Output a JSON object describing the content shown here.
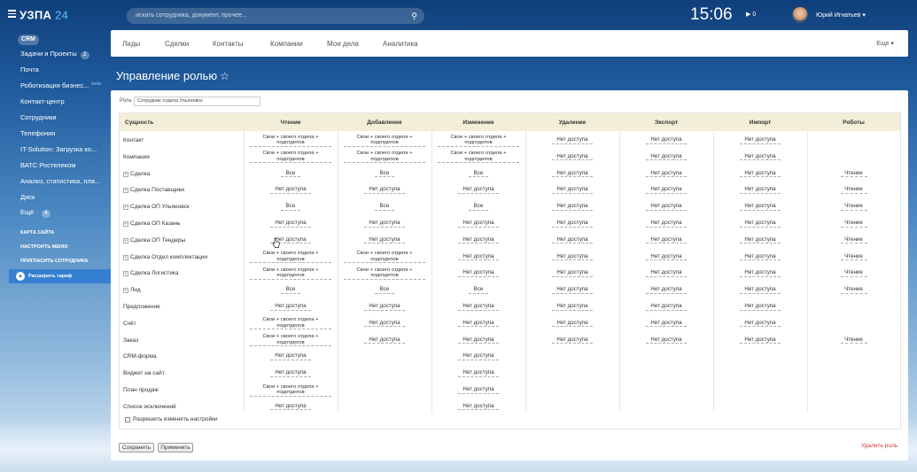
{
  "header": {
    "logo_text": "УЗПА",
    "logo_num": "24",
    "search_placeholder": "искать сотрудника, документ, прочее...",
    "clock": "15:06",
    "flag_count": "▶ 0",
    "user_name": "Юрий Игнатьев ▾"
  },
  "leftmenu": {
    "crm": "CRM",
    "items": [
      {
        "label": "Задачи и Проекты",
        "count": "2"
      },
      {
        "label": "Почта"
      },
      {
        "label": "Роботизация бизнес...",
        "beta": "beta"
      },
      {
        "label": "Контакт-центр"
      },
      {
        "label": "Сотрудники"
      },
      {
        "label": "Телефония"
      },
      {
        "label": "IT-Solution: Загрузка ко..."
      },
      {
        "label": "ВАТС Ростелеком"
      },
      {
        "label": "Анализ, статистика, пла..."
      },
      {
        "label": "Диск"
      },
      {
        "label": "Ещё ·",
        "count": "4"
      }
    ],
    "small_items": [
      "Карта сайта",
      "Настроить меню",
      "Пригласить сотрудника"
    ],
    "expand_label": "Расширить тариф"
  },
  "nav": {
    "items": [
      "Лиды",
      "Сделки",
      "Контакты",
      "Компании",
      "Мои дела",
      "Аналитика"
    ],
    "more": "Еще ▾"
  },
  "page": {
    "title": "Управление ролью",
    "star": "☆",
    "role_label": "Роль",
    "role_value": "Сотрудник отдела Ульяновск"
  },
  "table": {
    "columns": [
      "Сущность",
      "Чтение",
      "Добавление",
      "Изменение",
      "Удаление",
      "Экспорт",
      "Импорт",
      "Роботы"
    ],
    "rows": [
      {
        "name": "Контакт",
        "expand": false,
        "cells": [
          "Свои + своего отдела + подотделов",
          "Свои + своего отдела + подотделов",
          "Свои + своего отдела + подотделов",
          "Нет доступа",
          "Нет доступа",
          "Нет доступа",
          ""
        ]
      },
      {
        "name": "Компания",
        "expand": false,
        "cells": [
          "Свои + своего отдела + подотделов",
          "Свои + своего отдела + подотделов",
          "Свои + своего отдела + подотделов",
          "Нет доступа",
          "Нет доступа",
          "Нет доступа",
          ""
        ]
      },
      {
        "name": "Сделка",
        "expand": true,
        "cells": [
          "Все",
          "Все",
          "Все",
          "Нет доступа",
          "Нет доступа",
          "Нет доступа",
          "Чтение"
        ]
      },
      {
        "name": "Сделка Поставщики",
        "expand": true,
        "cells": [
          "Нет доступа",
          "Нет доступа",
          "Нет доступа",
          "Нет доступа",
          "Нет доступа",
          "Нет доступа",
          "Чтение"
        ]
      },
      {
        "name": "Сделка ОП Ульяновск",
        "expand": true,
        "cells": [
          "Все",
          "Все",
          "Все",
          "Нет доступа",
          "Нет доступа",
          "Нет доступа",
          "Чтение"
        ]
      },
      {
        "name": "Сделка ОП Казань",
        "expand": true,
        "cells": [
          "Нет доступа",
          "Нет доступа",
          "Нет доступа",
          "Нет доступа",
          "Нет доступа",
          "Нет доступа",
          "Чтение"
        ]
      },
      {
        "name": "Сделка ОП Тендеры",
        "expand": true,
        "cells": [
          "Нет доступа",
          "Нет доступа",
          "Нет доступа",
          "Нет доступа",
          "Нет доступа",
          "Нет доступа",
          "Чтение"
        ]
      },
      {
        "name": "Сделка Отдел комплектации",
        "expand": true,
        "cells": [
          "Свои + своего отдела + подотделов",
          "Свои + своего отдела + подотделов",
          "Нет доступа",
          "Нет доступа",
          "Нет доступа",
          "Нет доступа",
          "Чтение"
        ]
      },
      {
        "name": "Сделка Логистика",
        "expand": true,
        "cells": [
          "Свои + своего отдела + подотделов",
          "Свои + своего отдела + подотделов",
          "Нет доступа",
          "Нет доступа",
          "Нет доступа",
          "Нет доступа",
          "Чтение"
        ]
      },
      {
        "name": "Лид",
        "expand": true,
        "cells": [
          "Все",
          "Все",
          "Все",
          "Нет доступа",
          "Нет доступа",
          "Нет доступа",
          "Чтение"
        ]
      },
      {
        "name": "Предложение",
        "expand": false,
        "cells": [
          "Нет доступа",
          "Нет доступа",
          "Нет доступа",
          "Нет доступа",
          "Нет доступа",
          "Нет доступа",
          ""
        ]
      },
      {
        "name": "Счёт",
        "expand": false,
        "cells": [
          "Свои + своего отдела + подотделов",
          "Нет доступа",
          "Нет доступа",
          "Нет доступа",
          "Нет доступа",
          "Нет доступа",
          ""
        ]
      },
      {
        "name": "Заказ",
        "expand": false,
        "cells": [
          "Свои + своего отдела + подотделов",
          "Нет доступа",
          "Нет доступа",
          "Нет доступа",
          "Нет доступа",
          "Нет доступа",
          "Чтение"
        ]
      },
      {
        "name": "CRM-форма",
        "expand": false,
        "cells": [
          "Нет доступа",
          "",
          "Нет доступа",
          "",
          "",
          "",
          ""
        ]
      },
      {
        "name": "Виджет на сайт",
        "expand": false,
        "cells": [
          "Нет доступа",
          "",
          "Нет доступа",
          "",
          "",
          "",
          ""
        ]
      },
      {
        "name": "План продаж",
        "expand": false,
        "cells": [
          "Свои + своего отдела + подотделов",
          "",
          "Нет доступа",
          "",
          "",
          "",
          ""
        ]
      },
      {
        "name": "Список исключений",
        "expand": false,
        "cells": [
          "Нет доступа",
          "",
          "Нет доступа",
          "",
          "",
          "",
          ""
        ]
      }
    ]
  },
  "footer": {
    "allow_label": "Разрешить изменять настройки",
    "save": "Сохранить",
    "apply": "Применить",
    "delete": "Удалить роль"
  },
  "colors": {
    "accent": "#2878d2",
    "delete": "#d0352a",
    "header_row": "#f2eed8"
  }
}
